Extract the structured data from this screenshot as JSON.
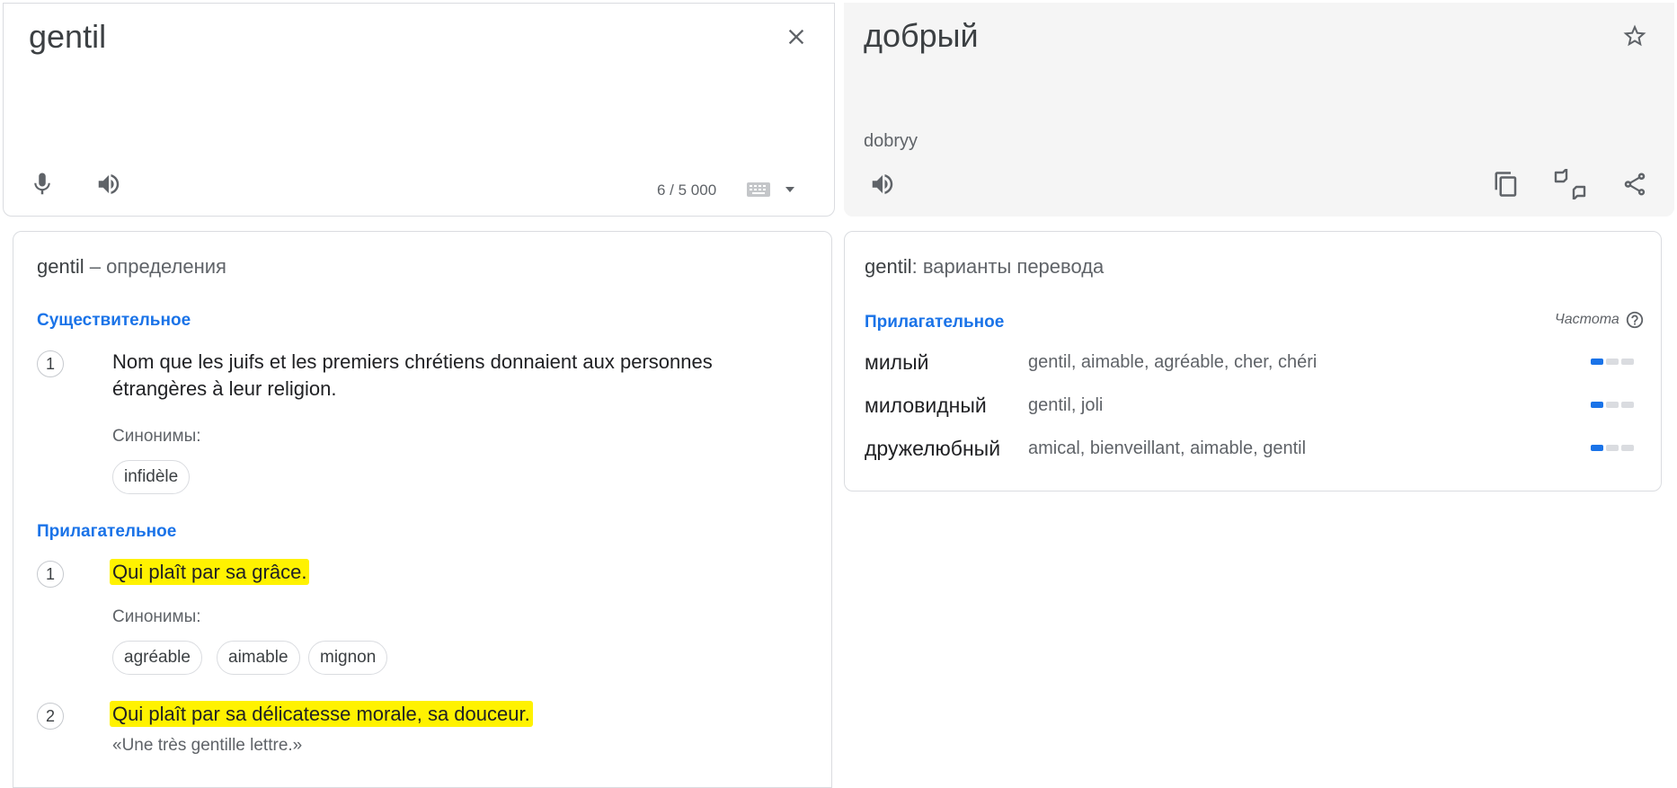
{
  "source": {
    "text": "gentil",
    "char_count": "6 / 5 000"
  },
  "target": {
    "text": "добрый",
    "transliteration": "dobryy"
  },
  "definitions": {
    "word": "gentil",
    "heading_suffix": "– определения",
    "noun_label": "Существительное",
    "noun_items": [
      {
        "num": "1",
        "text": "Nom que les juifs et les premiers chrétiens donnaient aux personnes étrangères à leur religion.",
        "synonyms": [
          "infidèle"
        ]
      }
    ],
    "synonyms_label": "Синонимы:",
    "adj_label": "Прилагательное",
    "adj_items": [
      {
        "num": "1",
        "text": "Qui plaît par sa grâce.",
        "synonyms": [
          "agréable",
          "aimable",
          "mignon"
        ]
      },
      {
        "num": "2",
        "text": "Qui plaît par sa délicatesse morale, sa douceur.",
        "example": "«Une très gentille lettre.»"
      }
    ]
  },
  "translations": {
    "word": "gentil",
    "heading_suffix": ": варианты перевода",
    "pos_label": "Прилагательное",
    "freq_label": "Частота",
    "rows": [
      {
        "word": "милый",
        "back": "gentil, aimable, agréable, cher, chéri",
        "frequency": 1
      },
      {
        "word": "миловидный",
        "back": "gentil, joli",
        "frequency": 1
      },
      {
        "word": "дружелюбный",
        "back": "amical, bienveillant, aimable, gentil",
        "frequency": 1
      }
    ]
  },
  "icons": {
    "clear": "close-icon",
    "mic": "microphone-icon",
    "listen": "speaker-icon",
    "keyboard": "keyboard-icon",
    "dropdown": "arrow-drop-down-icon",
    "star": "star-outline-icon",
    "copy": "copy-icon",
    "feedback": "thumbs-up-down-icon",
    "share": "share-icon",
    "help": "help-circle-icon"
  },
  "colors": {
    "accent": "#1a73e8",
    "highlight": "#fff200"
  }
}
